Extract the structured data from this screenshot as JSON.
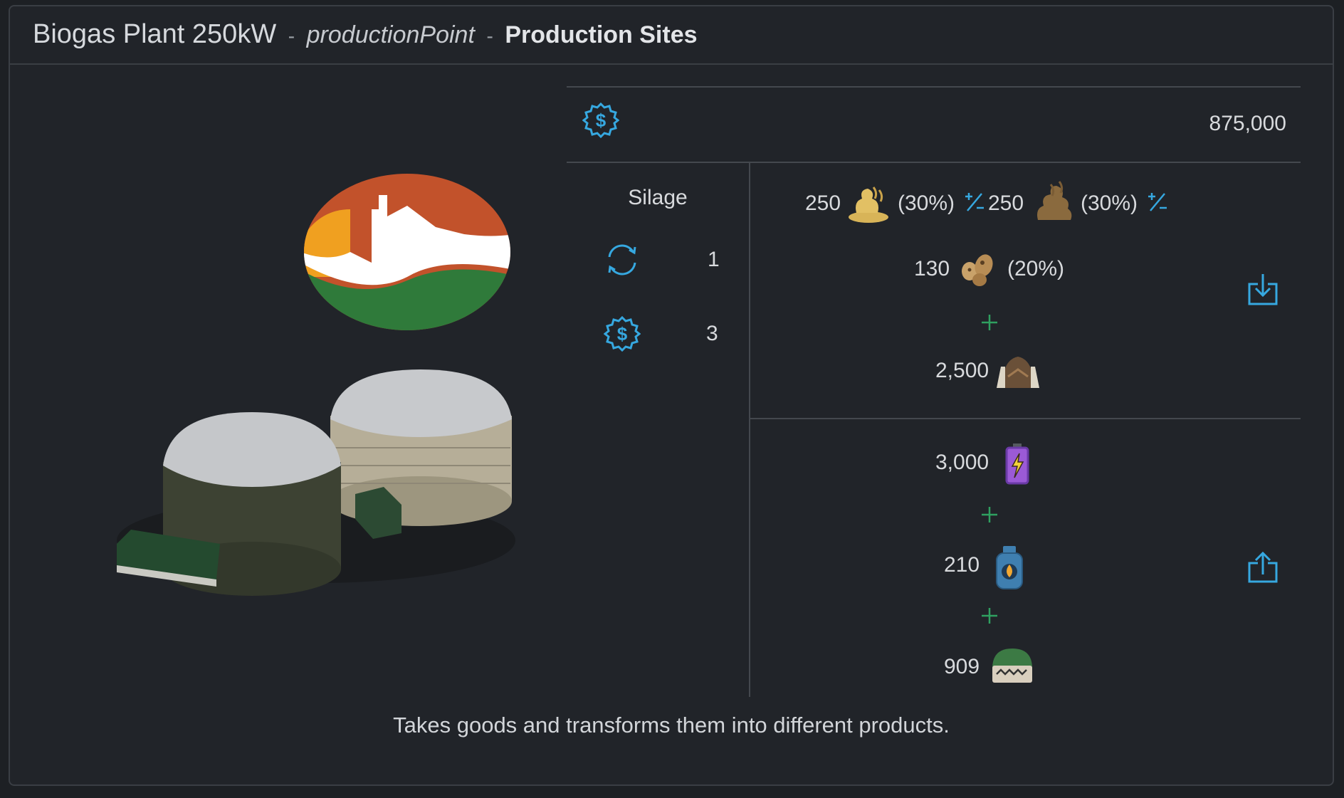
{
  "header": {
    "title": "Biogas Plant 250kW",
    "type": "productionPoint",
    "category": "Production Sites",
    "separator": "-"
  },
  "price": {
    "icon": "price-gear-dollar-icon",
    "value": "875,000"
  },
  "production": {
    "name": "Silage",
    "cycles": {
      "icon": "cycle-icon",
      "value": "1"
    },
    "cost": {
      "icon": "cost-gear-dollar-icon",
      "value": "3"
    }
  },
  "inputs": {
    "row1": {
      "a_amount": "250",
      "a_icon": "liquid-manure-icon",
      "a_pct": "(30%)",
      "b_amount": "250",
      "b_icon": "manure-icon",
      "b_pct": "(30%)",
      "mix_icon": "plus-minus-icon"
    },
    "row2": {
      "amount": "130",
      "icon": "digestate-icon",
      "pct": "(20%)"
    },
    "row3": {
      "amount": "2,500",
      "icon": "silage-bunker-icon"
    },
    "plus_icon": "plus-icon",
    "action_icon": "input-download-icon"
  },
  "outputs": {
    "row1": {
      "amount": "3,000",
      "icon": "electricity-battery-icon"
    },
    "row2": {
      "amount": "210",
      "icon": "methane-gas-bottle-icon"
    },
    "row3": {
      "amount": "909",
      "icon": "digestate-fertilizer-icon"
    },
    "action_icon": "output-upload-icon"
  },
  "description": "Takes goods and transforms them into different products.",
  "colors": {
    "accent": "#36a8e0",
    "plus": "#2fa060",
    "background": "#212429"
  }
}
